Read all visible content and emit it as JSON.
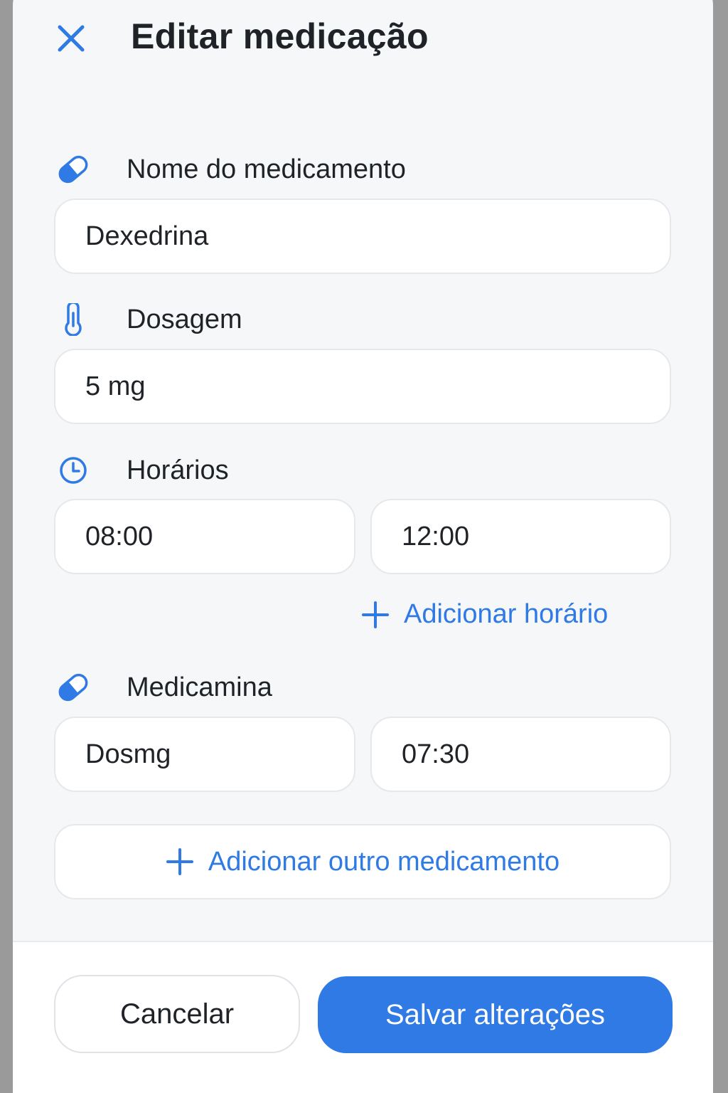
{
  "header": {
    "title": "Editar medicação",
    "close_icon": "close-icon"
  },
  "medication_name": {
    "label": "Nome do medicamento",
    "icon": "pill-icon",
    "value": "Dexedrina"
  },
  "dosage": {
    "label": "Dosagem",
    "icon": "thermometer-icon",
    "value": "5 mg"
  },
  "schedule": {
    "label": "Horários",
    "icon": "clock-icon",
    "times": [
      "08:00",
      "12:00"
    ],
    "add_label": "Adicionar horário"
  },
  "second_medication": {
    "label": "Medicamina",
    "icon": "pill-icon",
    "dose_value": "Dosmg",
    "time_value": "07:30"
  },
  "add_medication": {
    "label": "Adicionar outro medicamento"
  },
  "footer": {
    "cancel_label": "Cancelar",
    "save_label": "Salvar alterações"
  },
  "colors": {
    "accent": "#2f7ae5",
    "background": "#f6f7f9",
    "field": "#ffffff",
    "text": "#1f2328"
  }
}
